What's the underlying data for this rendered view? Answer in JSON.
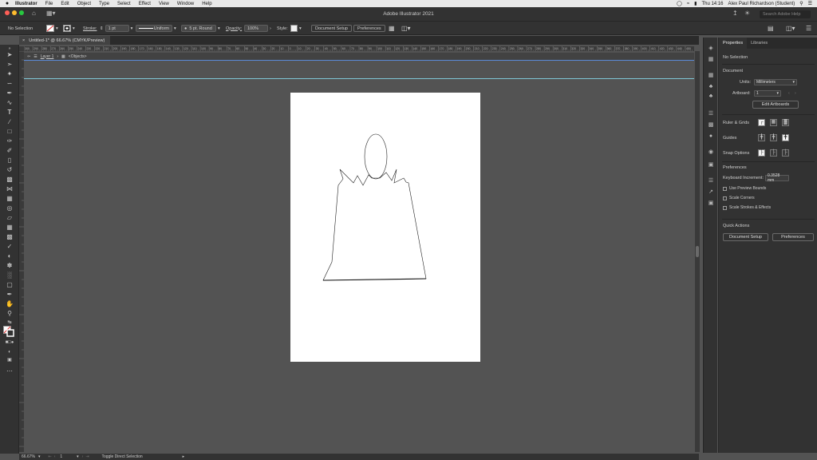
{
  "menubar": {
    "apple": "",
    "items": [
      "Illustrator",
      "File",
      "Edit",
      "Object",
      "Type",
      "Select",
      "Effect",
      "View",
      "Window",
      "Help"
    ],
    "clock": "Thu 14:16",
    "user": "Alex Paul Richardson (Student)"
  },
  "window": {
    "title": "Adobe Illustrator 2021",
    "search_placeholder": "Search Adobe Help"
  },
  "controlbar": {
    "selection": "No Selection",
    "stroke_label": "Stroke:",
    "stroke_value": "1 pt",
    "profile": "Uniform",
    "brush": "5 pt. Round",
    "opacity_label": "Opacity:",
    "opacity_value": "100%",
    "style_label": "Style:",
    "document_setup": "Document Setup",
    "preferences": "Preferences"
  },
  "document": {
    "tab_title": "Untitled-1* @ 66.67% (CMYK/Preview)",
    "breadcrumb_layer": "Layer 1",
    "breadcrumb_objects": "<Objects>"
  },
  "ruler": {
    "top_labels": [
      "300",
      "290",
      "280",
      "270",
      "260",
      "250",
      "240",
      "230",
      "220",
      "210",
      "200",
      "190",
      "180",
      "170",
      "160",
      "150",
      "140",
      "130",
      "120",
      "110",
      "100",
      "90",
      "80",
      "70",
      "60",
      "50",
      "40",
      "30",
      "20",
      "10",
      "0",
      "10",
      "20",
      "30",
      "40",
      "50",
      "60",
      "70",
      "80",
      "90",
      "100",
      "110",
      "120",
      "130",
      "140",
      "150",
      "160",
      "170",
      "180",
      "190",
      "200",
      "210",
      "220",
      "230",
      "240",
      "250",
      "260",
      "270",
      "280",
      "290",
      "300",
      "310",
      "320",
      "330",
      "340",
      "350",
      "360",
      "370",
      "380",
      "390",
      "400",
      "410",
      "420",
      "430",
      "440",
      "450"
    ]
  },
  "status": {
    "zoom": "66.67%",
    "artboard": "1",
    "tool": "Toggle Direct Selection"
  },
  "panel": {
    "tabs": [
      "Properties",
      "Libraries"
    ],
    "selection": "No Selection",
    "document_heading": "Document",
    "units_label": "Units:",
    "units_value": "Millimeters",
    "artboard_label": "Artboard:",
    "artboard_value": "1",
    "edit_artboards": "Edit Artboards",
    "ruler_grids": "Ruler & Grids",
    "guides": "Guides",
    "snap_options": "Snap Options",
    "preferences_heading": "Preferences",
    "keyboard_increment_label": "Keyboard Increment:",
    "keyboard_increment_value": "0.3528 mm",
    "use_preview_bounds": "Use Preview Bounds",
    "scale_corners": "Scale Corners",
    "scale_strokes": "Scale Strokes & Effects",
    "quick_actions": "Quick Actions",
    "document_setup": "Document Setup",
    "preferences": "Preferences"
  },
  "colors": {
    "accent": "#5b8ad6",
    "guide": "#7fc6d6"
  }
}
